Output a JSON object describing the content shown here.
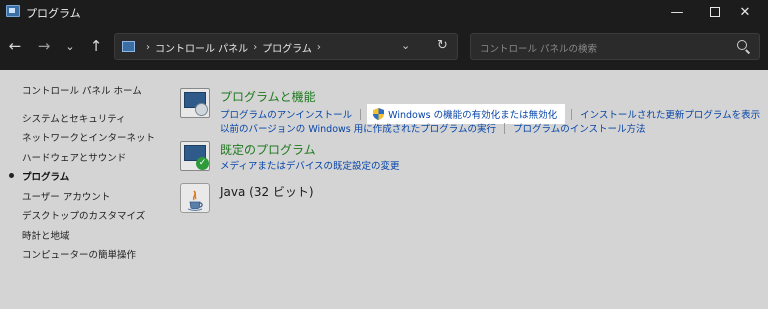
{
  "window": {
    "title": "プログラム",
    "minimize": "—",
    "close": "✕"
  },
  "nav": {
    "back": "←",
    "forward": "→",
    "recent": "⌄",
    "up": "↑",
    "breadcrumbs": [
      "コントロール パネル",
      "プログラム"
    ],
    "dropdown": "⌄",
    "refresh": "↻"
  },
  "search": {
    "placeholder": "コントロール パネルの検索"
  },
  "sidebar": {
    "home": "コントロール パネル ホーム",
    "items": [
      {
        "label": "システムとセキュリティ"
      },
      {
        "label": "ネットワークとインターネット"
      },
      {
        "label": "ハードウェアとサウンド"
      },
      {
        "label": "プログラム",
        "active": true
      },
      {
        "label": "ユーザー アカウント"
      },
      {
        "label": "デスクトップのカスタマイズ"
      },
      {
        "label": "時計と地域"
      },
      {
        "label": "コンピューターの簡単操作"
      }
    ]
  },
  "main": {
    "programs": {
      "title": "プログラムと機能",
      "links_row1": [
        "プログラムのアンインストール",
        "Windows の機能の有効化または無効化",
        "インストールされた更新プログラムを表示"
      ],
      "links_row2": [
        "以前のバージョンの Windows 用に作成されたプログラムの実行",
        "プログラムのインストール方法"
      ]
    },
    "defaults": {
      "title": "既定のプログラム",
      "link": "メディアまたはデバイスの既定設定の変更"
    },
    "java": {
      "title": "Java (32 ビット)"
    }
  },
  "colors": {
    "titlebar": "#1c1c1c",
    "background": "#d4d4d4",
    "section_title": "#1e7a1e",
    "link": "#0645a8"
  }
}
